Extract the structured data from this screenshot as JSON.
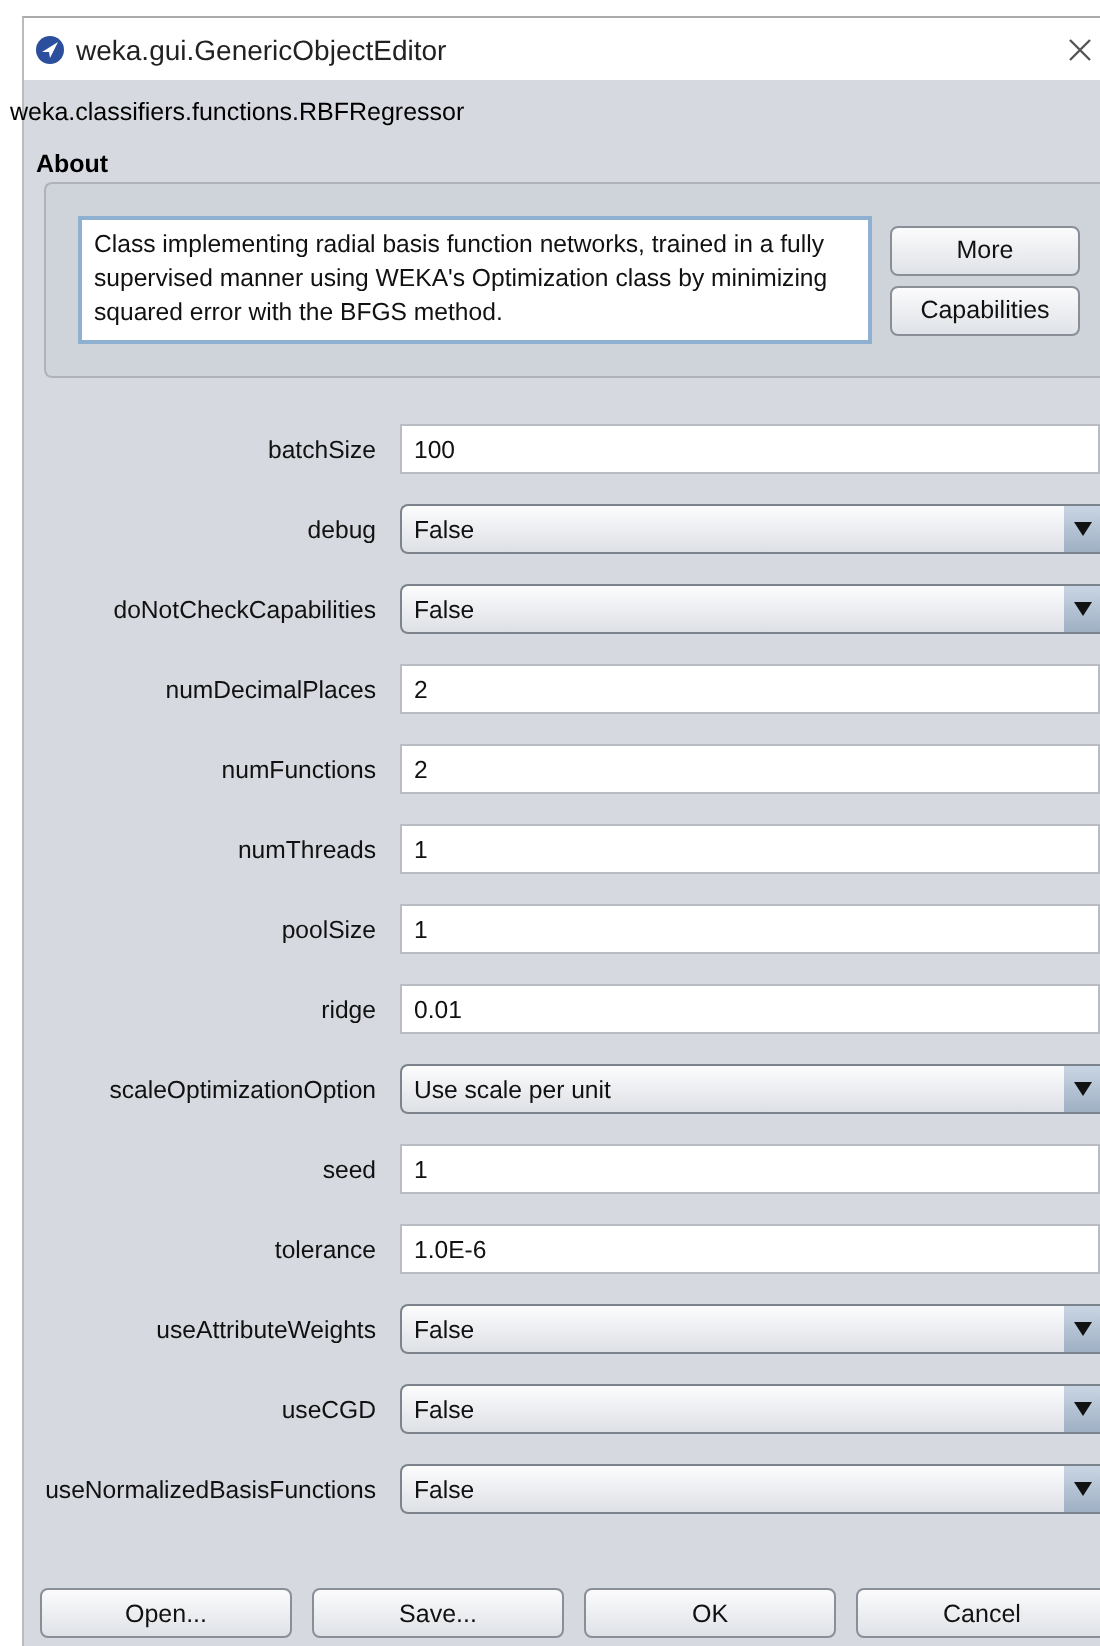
{
  "window": {
    "title": "weka.gui.GenericObjectEditor"
  },
  "class_name": "weka.classifiers.functions.RBFRegressor",
  "about": {
    "title": "About",
    "text": "Class implementing radial basis function networks, trained in a fully supervised manner using WEKA's Optimization class by minimizing squared error with the BFGS method.",
    "buttons": [
      "More",
      "Capabilities"
    ]
  },
  "properties": [
    {
      "label": "batchSize",
      "kind": "text",
      "value": "100"
    },
    {
      "label": "debug",
      "kind": "dropdown",
      "value": "False"
    },
    {
      "label": "doNotCheckCapabilities",
      "kind": "dropdown",
      "value": "False"
    },
    {
      "label": "numDecimalPlaces",
      "kind": "text",
      "value": "2"
    },
    {
      "label": "numFunctions",
      "kind": "text",
      "value": "2"
    },
    {
      "label": "numThreads",
      "kind": "text",
      "value": "1"
    },
    {
      "label": "poolSize",
      "kind": "text",
      "value": "1"
    },
    {
      "label": "ridge",
      "kind": "text",
      "value": "0.01"
    },
    {
      "label": "scaleOptimizationOption",
      "kind": "dropdown",
      "value": "Use scale per unit"
    },
    {
      "label": "seed",
      "kind": "text",
      "value": "1"
    },
    {
      "label": "tolerance",
      "kind": "text",
      "value": "1.0E-6"
    },
    {
      "label": "useAttributeWeights",
      "kind": "dropdown",
      "value": "False"
    },
    {
      "label": "useCGD",
      "kind": "dropdown",
      "value": "False"
    },
    {
      "label": "useNormalizedBasisFunctions",
      "kind": "dropdown",
      "value": "False"
    }
  ],
  "buttons": [
    "Open...",
    "Save...",
    "OK",
    "Cancel"
  ]
}
